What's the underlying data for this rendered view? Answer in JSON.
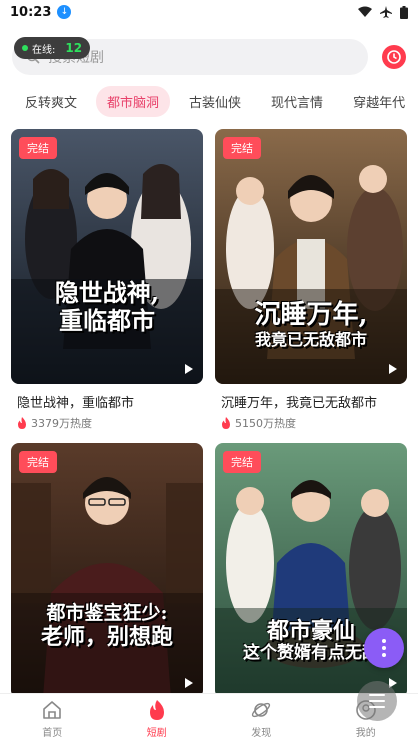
{
  "status_bar": {
    "time": "10:23"
  },
  "online": {
    "label": "在线:",
    "count": "12"
  },
  "search": {
    "placeholder": "搜索短剧"
  },
  "tabs": [
    {
      "label": "反转爽文",
      "active": false
    },
    {
      "label": "都市脑洞",
      "active": true
    },
    {
      "label": "古装仙侠",
      "active": false
    },
    {
      "label": "现代言情",
      "active": false
    },
    {
      "label": "穿越年代",
      "active": false
    }
  ],
  "cards": [
    {
      "badge": "完结",
      "poster_text_1": "隐世战神,",
      "poster_text_2": "重临都市",
      "title": "隐世战神，重临都市",
      "heat": "3379万热度"
    },
    {
      "badge": "完结",
      "poster_text_1": "沉睡万年,",
      "poster_text_2": "我竟已无敌都市",
      "title": "沉睡万年，我竟已无敌都市",
      "heat": "5150万热度"
    },
    {
      "badge": "完结",
      "poster_text_1": "都市鉴宝狂少:",
      "poster_text_2": "老师，别想跑",
      "title": "",
      "heat": ""
    },
    {
      "badge": "完结",
      "poster_text_1": "都市豪仙",
      "poster_text_2": "这个赘婿有点无敌",
      "title": "",
      "heat": ""
    }
  ],
  "bottom_nav": [
    {
      "label": "首页",
      "icon": "home-icon",
      "active": false
    },
    {
      "label": "短剧",
      "icon": "flame-icon",
      "active": true
    },
    {
      "label": "发现",
      "icon": "planet-icon",
      "active": false
    },
    {
      "label": "我的",
      "icon": "profile-icon",
      "active": false
    }
  ],
  "colors": {
    "accent": "#ff3b4e",
    "tab_active_bg": "#fde4e8",
    "fab": "#8b5cf6"
  }
}
